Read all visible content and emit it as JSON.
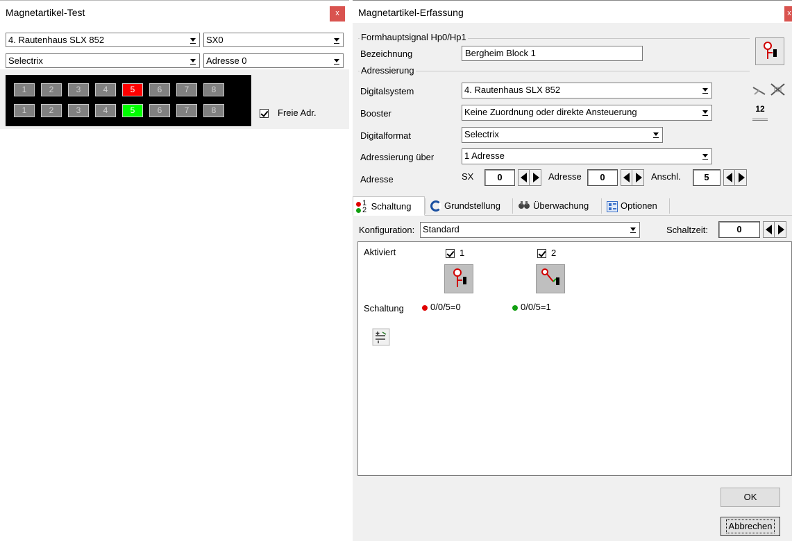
{
  "left_window": {
    "title": "Magnetartikel-Test",
    "close_label": "x",
    "digital_system": "4. Rautenhaus SLX 852",
    "sx_select": "SX0",
    "format_select": "Selectrix",
    "address_select": "Adresse 0",
    "row1": [
      "1",
      "2",
      "3",
      "4",
      "5",
      "6",
      "7",
      "8"
    ],
    "row2": [
      "1",
      "2",
      "3",
      "4",
      "5",
      "6",
      "7",
      "8"
    ],
    "row1_active": "5",
    "row2_active": "5",
    "free_addr_label": "Freie Adr.",
    "free_addr_checked": true
  },
  "right_window": {
    "title": "Magnetartikel-Erfassung",
    "close_label": "x",
    "group_signal": "Formhauptsignal Hp0/Hp1",
    "bezeichnung_label": "Bezeichnung",
    "bezeichnung_value": "Bergheim Block 1",
    "group_address": "Adressierung",
    "digitalsystem_label": "Digitalsystem",
    "digitalsystem_value": "4. Rautenhaus SLX 852",
    "booster_label": "Booster",
    "booster_value": "Keine Zuordnung oder direkte Ansteuerung",
    "digitalformat_label": "Digitalformat",
    "digitalformat_value": "Selectrix",
    "adressierung_label": "Adressierung über",
    "adressierung_value": "1 Adresse",
    "adresse_label": "Adresse",
    "sx_label": "SX",
    "sx_value": "0",
    "adresse2_label": "Adresse",
    "adresse2_value": "0",
    "anschl_label": "Anschl.",
    "anschl_value": "5",
    "icon_12_label": "12",
    "tabs": [
      {
        "label": "Schaltung",
        "icon": "switching-icon"
      },
      {
        "label": "Grundstellung",
        "icon": "reset-icon"
      },
      {
        "label": "Überwachung",
        "icon": "binoculars-icon"
      },
      {
        "label": "Optionen",
        "icon": "options-icon"
      }
    ],
    "tab_icon_glyph": {
      "top": "1",
      "bottom": "2"
    },
    "konfiguration_label": "Konfiguration:",
    "konfiguration_value": "Standard",
    "schaltzeit_label": "Schaltzeit:",
    "schaltzeit_value": "0",
    "aktiviert_label": "Aktiviert",
    "switch1_label": "1",
    "switch2_label": "2",
    "schaltung_label": "Schaltung",
    "schaltung1_value": "0/0/5=0",
    "schaltung2_value": "0/0/5=1",
    "ok_label": "OK",
    "cancel_label": "Abbrechen"
  },
  "colors": {
    "red": "#ff0000",
    "green": "#00ff00",
    "dot_red": "#e00000",
    "dot_green": "#12a012"
  }
}
